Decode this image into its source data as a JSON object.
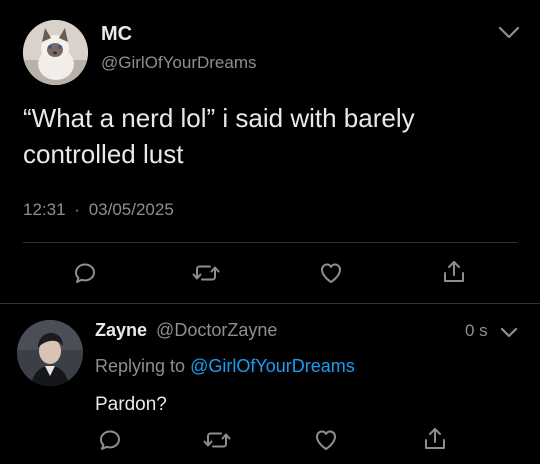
{
  "tweet": {
    "author_name": "MC",
    "author_handle": "@GirlOfYourDreams",
    "text": "“What a nerd lol” i said with barely controlled lust",
    "timestamp": "12:31",
    "separator": "·",
    "date": "03/05/2025"
  },
  "reply": {
    "author_name": "Zayne",
    "author_handle": "@DoctorZayne",
    "time_ago": "0 s",
    "replying_prefix": "Replying to",
    "replying_to": "@GirlOfYourDreams",
    "text": "Pardon?"
  },
  "icons": {
    "more": "chevron-down-icon",
    "reply": "reply-icon",
    "retweet": "retweet-icon",
    "like": "heart-icon",
    "share": "share-icon"
  },
  "colors": {
    "background": "#000000",
    "text": "#e7e9ea",
    "muted": "#8b8f93",
    "link": "#1d9bf0",
    "divider": "#2f3336"
  }
}
